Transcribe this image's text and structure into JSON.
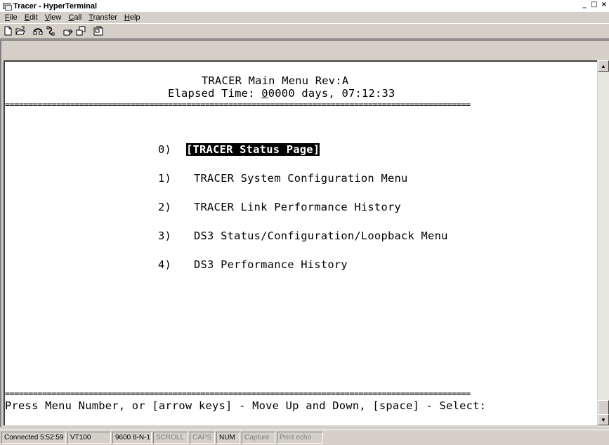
{
  "window": {
    "title": "Tracer - HyperTerminal",
    "controls": [
      "_",
      "□",
      "×"
    ]
  },
  "menubar": {
    "items": [
      {
        "acc": "F",
        "rest": "ile"
      },
      {
        "acc": "E",
        "rest": "dit"
      },
      {
        "acc": "V",
        "rest": "iew"
      },
      {
        "acc": "C",
        "rest": "all"
      },
      {
        "acc": "T",
        "rest": "ransfer"
      },
      {
        "acc": "H",
        "rest": "elp"
      }
    ]
  },
  "toolbar": {
    "icons": [
      "new-icon",
      "open-icon",
      "connect-icon",
      "disconnect-icon",
      "send-icon",
      "receive-icon",
      "properties-icon"
    ]
  },
  "terminal": {
    "header_line1": "TRACER Main Menu Rev:A",
    "header_line2_prefix": "Elapsed Time: ",
    "header_line2_cursor": "0",
    "header_line2_rest": "0000 days, 07:12:33",
    "separator": "====================================================================================================",
    "menu": [
      {
        "num": "0)",
        "label": "[TRACER Status Page]",
        "selected": true
      },
      {
        "num": "1)",
        "label": "TRACER System Configuration Menu",
        "selected": false
      },
      {
        "num": "2)",
        "label": "TRACER Link Performance History",
        "selected": false
      },
      {
        "num": "3)",
        "label": "DS3 Status/Configuration/Loopback Menu",
        "selected": false
      },
      {
        "num": "4)",
        "label": "DS3 Performance History",
        "selected": false
      }
    ],
    "prompt": "Press Menu Number, or [arrow keys] - Move Up and Down, [space] - Select:"
  },
  "statusbar": {
    "connected": "Connected 5:52:59",
    "emulation": "VT100",
    "settings": "9600 8-N-1",
    "scroll": "SCROLL",
    "caps": "CAPS",
    "num": "NUM",
    "capture": "Capture",
    "print_echo": "Print echo"
  }
}
